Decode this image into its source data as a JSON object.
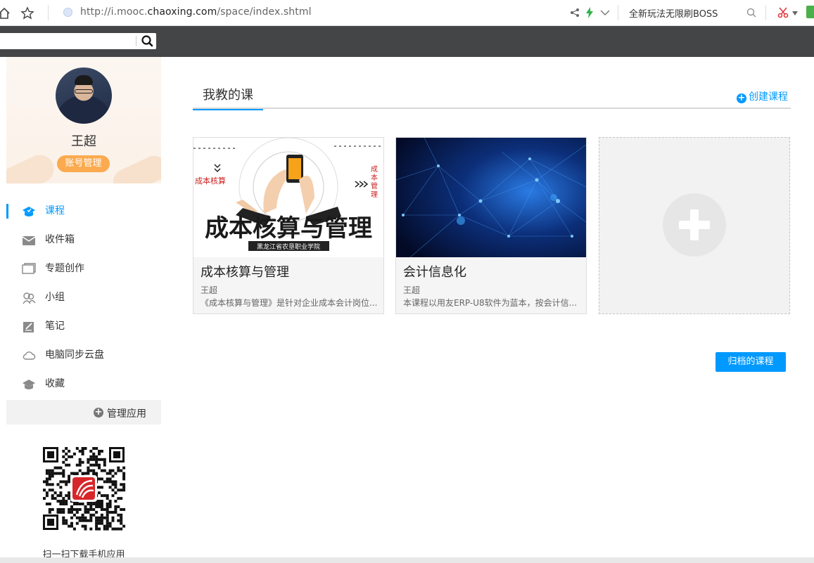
{
  "browser": {
    "url_prefix": "http://i.mooc.",
    "url_domain": "chaoxing.com",
    "url_path": "/space/index.shtml",
    "promo_text": "全新玩法无限刷BOSS"
  },
  "header": {
    "search_placeholder": ""
  },
  "sidebar": {
    "user_name": "王超",
    "account_button": "账号管理",
    "items": [
      {
        "label": "课程",
        "icon": "graduation-cap-icon",
        "active": true
      },
      {
        "label": "收件箱",
        "icon": "inbox-icon",
        "active": false
      },
      {
        "label": "专题创作",
        "icon": "topic-pages-icon",
        "active": false
      },
      {
        "label": "小组",
        "icon": "group-icon",
        "active": false
      },
      {
        "label": "笔记",
        "icon": "notebook-icon",
        "active": false
      },
      {
        "label": "电脑同步云盘",
        "icon": "cloud-icon",
        "active": false
      },
      {
        "label": "收藏",
        "icon": "favorites-icon",
        "active": false
      }
    ],
    "manage_apps": "管理应用",
    "qr_caption": "扫一扫下载手机应用"
  },
  "main": {
    "tab_label": "我教的课",
    "create_course": "创建课程",
    "courses": [
      {
        "name": "成本核算与管理",
        "teacher": "王超",
        "description": "《成本核算与管理》是针对企业成本会计岗位...",
        "cover_title": "成本核算与管理",
        "cover_left_text": "成本核算",
        "cover_right_text": "成本管理",
        "cover_subtitle": "黑龙江省农垦职业学院"
      },
      {
        "name": "会计信息化",
        "teacher": "王超",
        "description": "本课程以用友ERP-U8软件为蓝本，按会计信..."
      }
    ],
    "archived_button": "归档的课程"
  },
  "colors": {
    "accent": "#0099ff",
    "account_button": "#fbaa4f",
    "header_bg": "#444546"
  }
}
